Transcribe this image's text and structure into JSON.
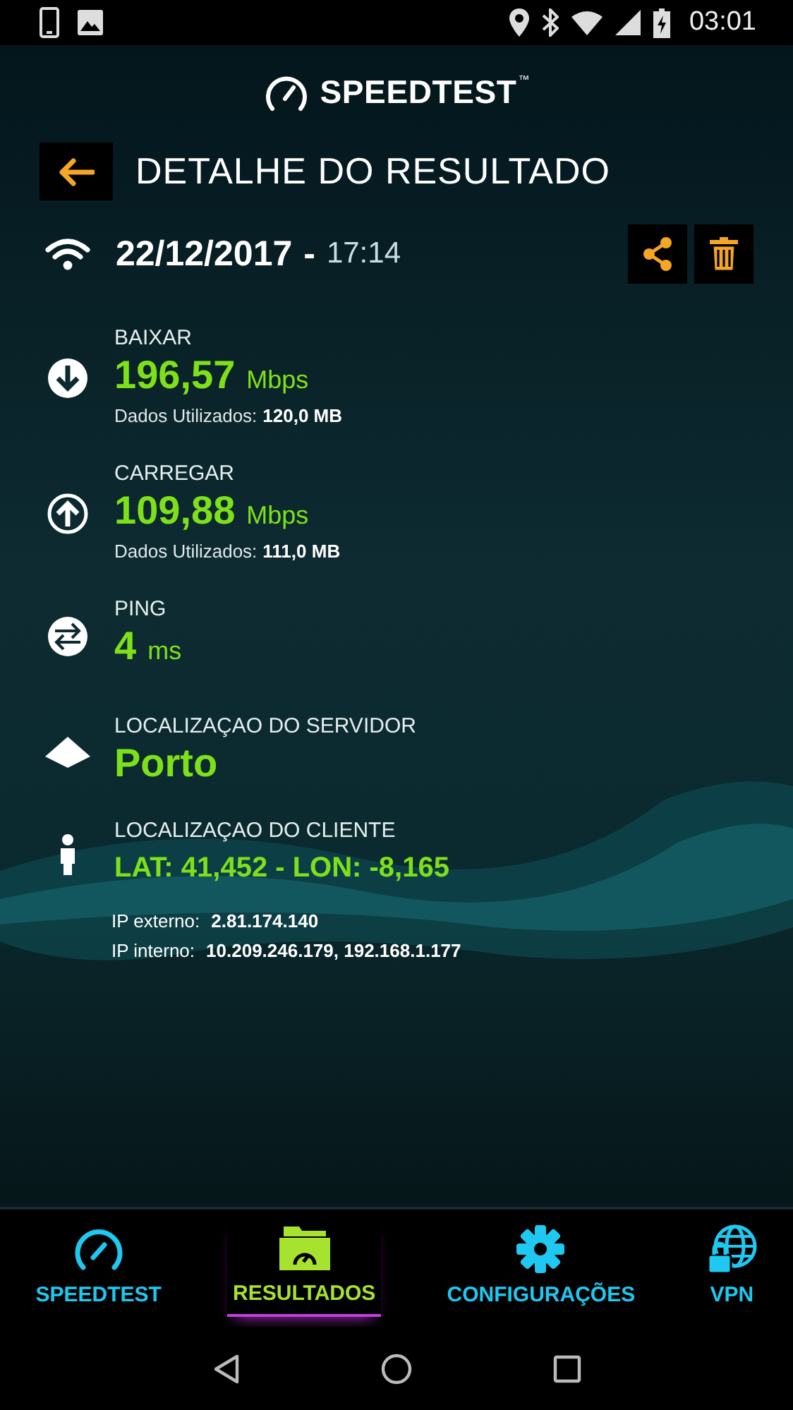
{
  "status_bar": {
    "time": "03:01"
  },
  "app": {
    "logo": "SPEEDTEST",
    "trademark": "™"
  },
  "header": {
    "title": "DETALHE DO RESULTADO"
  },
  "result": {
    "date": "22/12/2017",
    "separator": "-",
    "time": "17:14"
  },
  "metrics": [
    {
      "kind": "download",
      "label": "BAIXAR",
      "value": "196,57",
      "unit": "Mbps",
      "detail_label": "Dados Utilizados:",
      "detail_value": "120,0 MB"
    },
    {
      "kind": "upload",
      "label": "CARREGAR",
      "value": "109,88",
      "unit": "Mbps",
      "detail_label": "Dados Utilizados:",
      "detail_value": "111,0 MB"
    },
    {
      "kind": "ping",
      "label": "PING",
      "value": "4",
      "unit": "ms"
    },
    {
      "kind": "server",
      "label": "LOCALIZAÇAO DO SERVIDOR",
      "value": "Porto"
    },
    {
      "kind": "client",
      "label": "LOCALIZAÇAO DO CLIENTE",
      "value": "LAT: 41,452 - LON: -8,165"
    }
  ],
  "ip": [
    {
      "label": "IP externo:",
      "value": "2.81.174.140"
    },
    {
      "label": "IP interno:",
      "value": "10.209.246.179, 192.168.1.177"
    }
  ],
  "tabs": [
    {
      "kind": "speedtest",
      "label": "SPEEDTEST",
      "selected": false
    },
    {
      "kind": "results",
      "label": "RESULTADOS",
      "selected": true
    },
    {
      "kind": "settings",
      "label": "CONFIGURAÇÕES",
      "selected": false
    },
    {
      "kind": "vpn",
      "label": "VPN",
      "selected": false
    }
  ]
}
